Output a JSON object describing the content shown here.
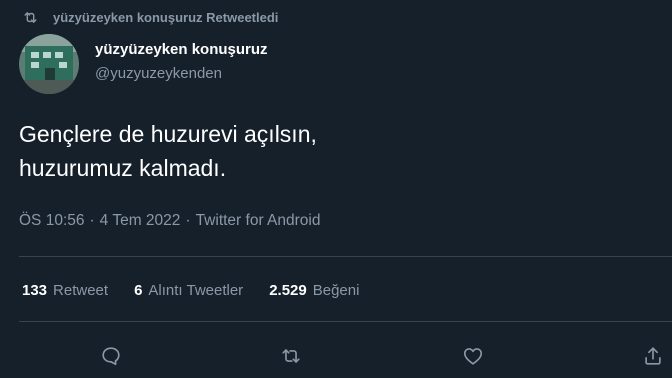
{
  "retweet_context": {
    "icon": "retweet-icon",
    "text": "yüzyüzeyken konuşuruz Retweetledi"
  },
  "author": {
    "display_name": "yüzyüzeyken konuşuruz",
    "handle": "@yuzyuzeykenden"
  },
  "tweet": {
    "text_line1": "Gençlere de huzurevi açılsın,",
    "text_line2": "huzurumuz kalmadı.",
    "time": "ÖS 10:56",
    "separator": "·",
    "date": "4 Tem 2022",
    "source": "Twitter for Android"
  },
  "stats": {
    "retweets": {
      "count": "133",
      "label": "Retweet"
    },
    "quotes": {
      "count": "6",
      "label": "Alıntı Tweetler"
    },
    "likes": {
      "count": "2.529",
      "label": "Beğeni"
    }
  },
  "actions": {
    "reply_icon": "reply-icon",
    "retweet_icon": "retweet-icon",
    "like_icon": "heart-icon",
    "share_icon": "share-icon"
  },
  "colors": {
    "background": "#15202b",
    "primary_text": "#ffffff",
    "secondary_text": "#8b98a5",
    "divider": "#38444d"
  }
}
